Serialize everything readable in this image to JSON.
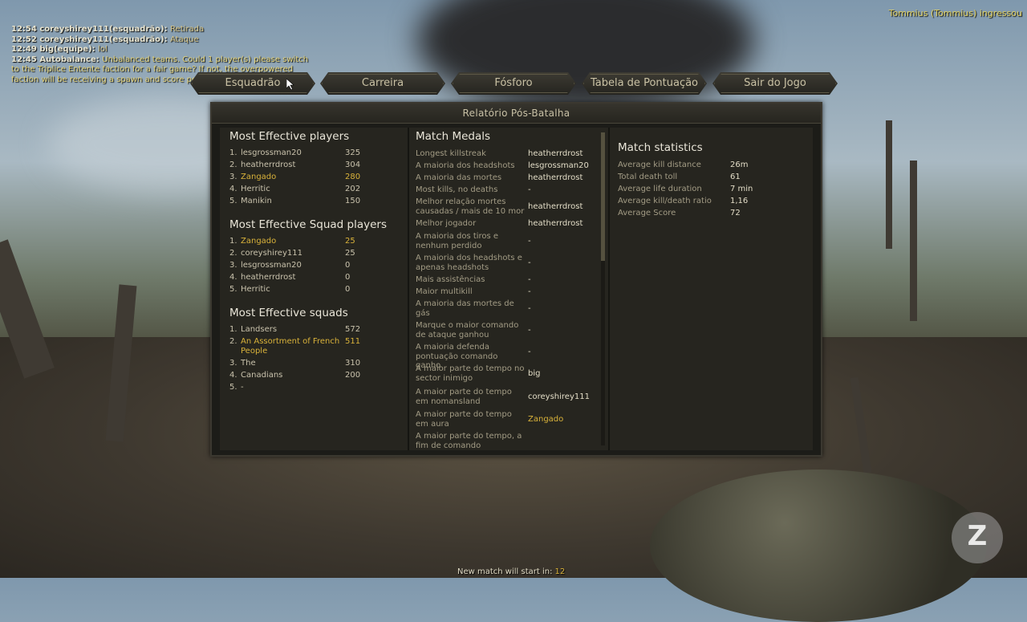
{
  "chat": [
    {
      "time": "12:54",
      "who": "coreyshirey111(esquadrão):",
      "msg": "Retirada"
    },
    {
      "time": "12:52",
      "who": "coreyshirey111(esquadrão):",
      "msg": "Ataque"
    },
    {
      "time": "12:49",
      "who": "big(equipe):",
      "msg": "lol"
    },
    {
      "time": "12:45",
      "who": "Autobalance:",
      "msg": "Unbalanced teams. Could 1 player(s) please switch to the Triplice Entente faction for a fair game? If not, the overpowered faction will be receiving a spawn and score penalty."
    }
  ],
  "join_notice": "Tommius (Tommius) ingressou",
  "nav": [
    "Esquadrão",
    "Carreira",
    "Fósforo",
    "Tabela de Pontuação",
    "Sair do Jogo"
  ],
  "panel_title": "Relatório Pós-Batalha",
  "players": {
    "title": "Most Effective players",
    "rows": [
      {
        "n": "1.",
        "name": "lesgrossman20",
        "score": "325"
      },
      {
        "n": "2.",
        "name": "heatherrdrost",
        "score": "304"
      },
      {
        "n": "3.",
        "name": "Zangado",
        "score": "280"
      },
      {
        "n": "4.",
        "name": "Herritic",
        "score": "202"
      },
      {
        "n": "5.",
        "name": "Manikin",
        "score": "150"
      }
    ]
  },
  "squad_players": {
    "title": "Most Effective Squad players",
    "rows": [
      {
        "n": "1.",
        "name": "Zangado",
        "score": "25"
      },
      {
        "n": "2.",
        "name": "coreyshirey111",
        "score": "25"
      },
      {
        "n": "3.",
        "name": "lesgrossman20",
        "score": "0"
      },
      {
        "n": "4.",
        "name": "heatherrdrost",
        "score": "0"
      },
      {
        "n": "5.",
        "name": "Herritic",
        "score": "0"
      }
    ]
  },
  "squads": {
    "title": "Most Effective squads",
    "rows": [
      {
        "n": "1.",
        "name": "Landsers",
        "score": "572"
      },
      {
        "n": "2.",
        "name": "An Assortment of French People",
        "score": "511"
      },
      {
        "n": "3.",
        "name": "The",
        "score": "310"
      },
      {
        "n": "4.",
        "name": "Canadians",
        "score": "200"
      },
      {
        "n": "5.",
        "name": "-",
        "score": ""
      }
    ]
  },
  "medals": {
    "title": "Match Medals",
    "rows": [
      {
        "label": "Longest killstreak",
        "value": "heatherrdrost"
      },
      {
        "label": "A maioria dos headshots",
        "value": "lesgrossman20"
      },
      {
        "label": "A maioria das mortes",
        "value": "heatherrdrost"
      },
      {
        "label": "Most kills, no deaths",
        "value": "-"
      },
      {
        "label": "Melhor relação mortes causadas / mais de 10 mor",
        "value": "heatherrdrost"
      },
      {
        "label": "Melhor jogador",
        "value": "heatherrdrost"
      },
      {
        "label": "A maioria dos tiros e nenhum perdido",
        "value": "-"
      },
      {
        "label": "A maioria dos headshots e apenas headshots",
        "value": "-"
      },
      {
        "label": "Mais assistências",
        "value": "-"
      },
      {
        "label": "Maior multikill",
        "value": "-"
      },
      {
        "label": "A maioria das mortes de gás",
        "value": "-"
      },
      {
        "label": "Marque o maior comando de ataque ganhou",
        "value": "-"
      },
      {
        "label": "A maioria defenda pontuação comando ganho",
        "value": "-"
      },
      {
        "label": "A maior parte do tempo no sector inimigo",
        "value": "big"
      },
      {
        "label": "A maior parte do tempo em nomansland",
        "value": "coreyshirey111"
      },
      {
        "label": "A maior parte do tempo em aura",
        "value": "Zangado"
      },
      {
        "label": "A maior parte do tempo, a fim de comando",
        "value": ""
      }
    ]
  },
  "stats": {
    "title": "Match statistics",
    "rows": [
      {
        "label": "Average kill distance",
        "value": "26m"
      },
      {
        "label": "Total death toll",
        "value": "61"
      },
      {
        "label": "Average life duration",
        "value": "7 min"
      },
      {
        "label": "Average kill/death ratio",
        "value": "1,16"
      },
      {
        "label": "Average Score",
        "value": "72"
      }
    ]
  },
  "footer": {
    "text": "New match will start in:",
    "count": "12"
  },
  "watermark": "Z",
  "colors": {
    "highlight": "#d9b23a",
    "panel": "#26251f",
    "text": "#c9c2ac"
  }
}
